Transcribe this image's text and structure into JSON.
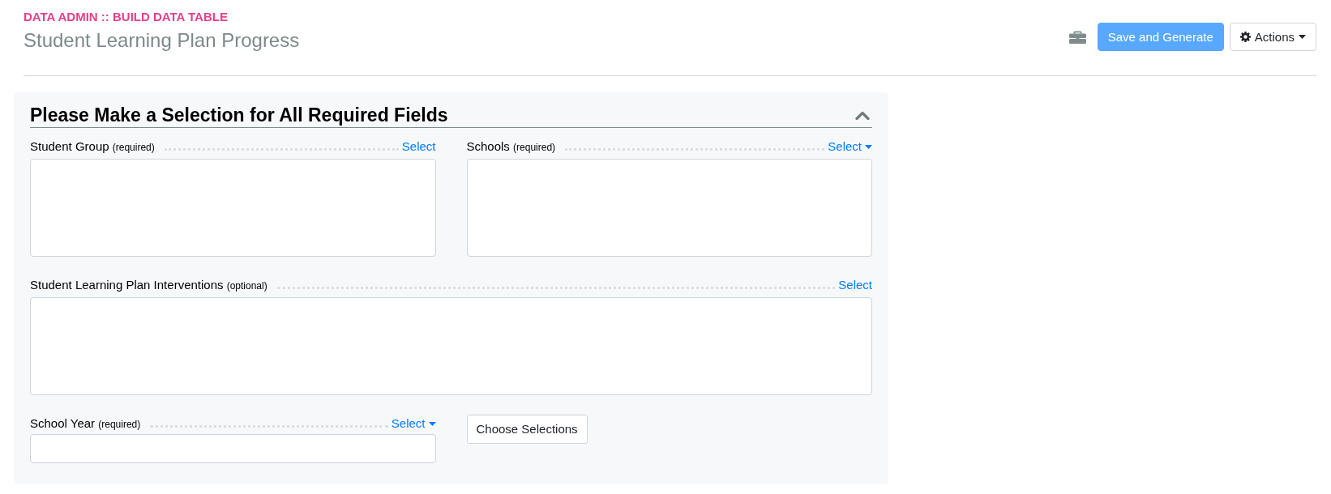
{
  "header": {
    "breadcrumb": "DATA ADMIN :: BUILD DATA TABLE",
    "title": "Student Learning Plan Progress"
  },
  "toolbar": {
    "save_button": {
      "label": "Save and Generate",
      "disabled": true
    },
    "actions_button": {
      "label": "Actions"
    }
  },
  "panel": {
    "title": "Please Make a Selection for All Required Fields",
    "expanded": true,
    "rows": [
      [
        {
          "kind": "list",
          "label": "Student Group",
          "note": "(required)",
          "link": "Select",
          "dropdown": false
        },
        {
          "kind": "list",
          "label": "Schools",
          "note": "(required)",
          "link": "Select",
          "dropdown": true
        }
      ],
      [
        {
          "kind": "list",
          "label": "Student Learning Plan Interventions",
          "note": "(optional)",
          "link": "Select",
          "dropdown": false
        }
      ],
      [
        {
          "kind": "input",
          "label": "School Year",
          "note": "(required)",
          "link": "Select",
          "dropdown": true
        },
        {
          "kind": "button",
          "label": "Choose Selections"
        }
      ]
    ]
  }
}
